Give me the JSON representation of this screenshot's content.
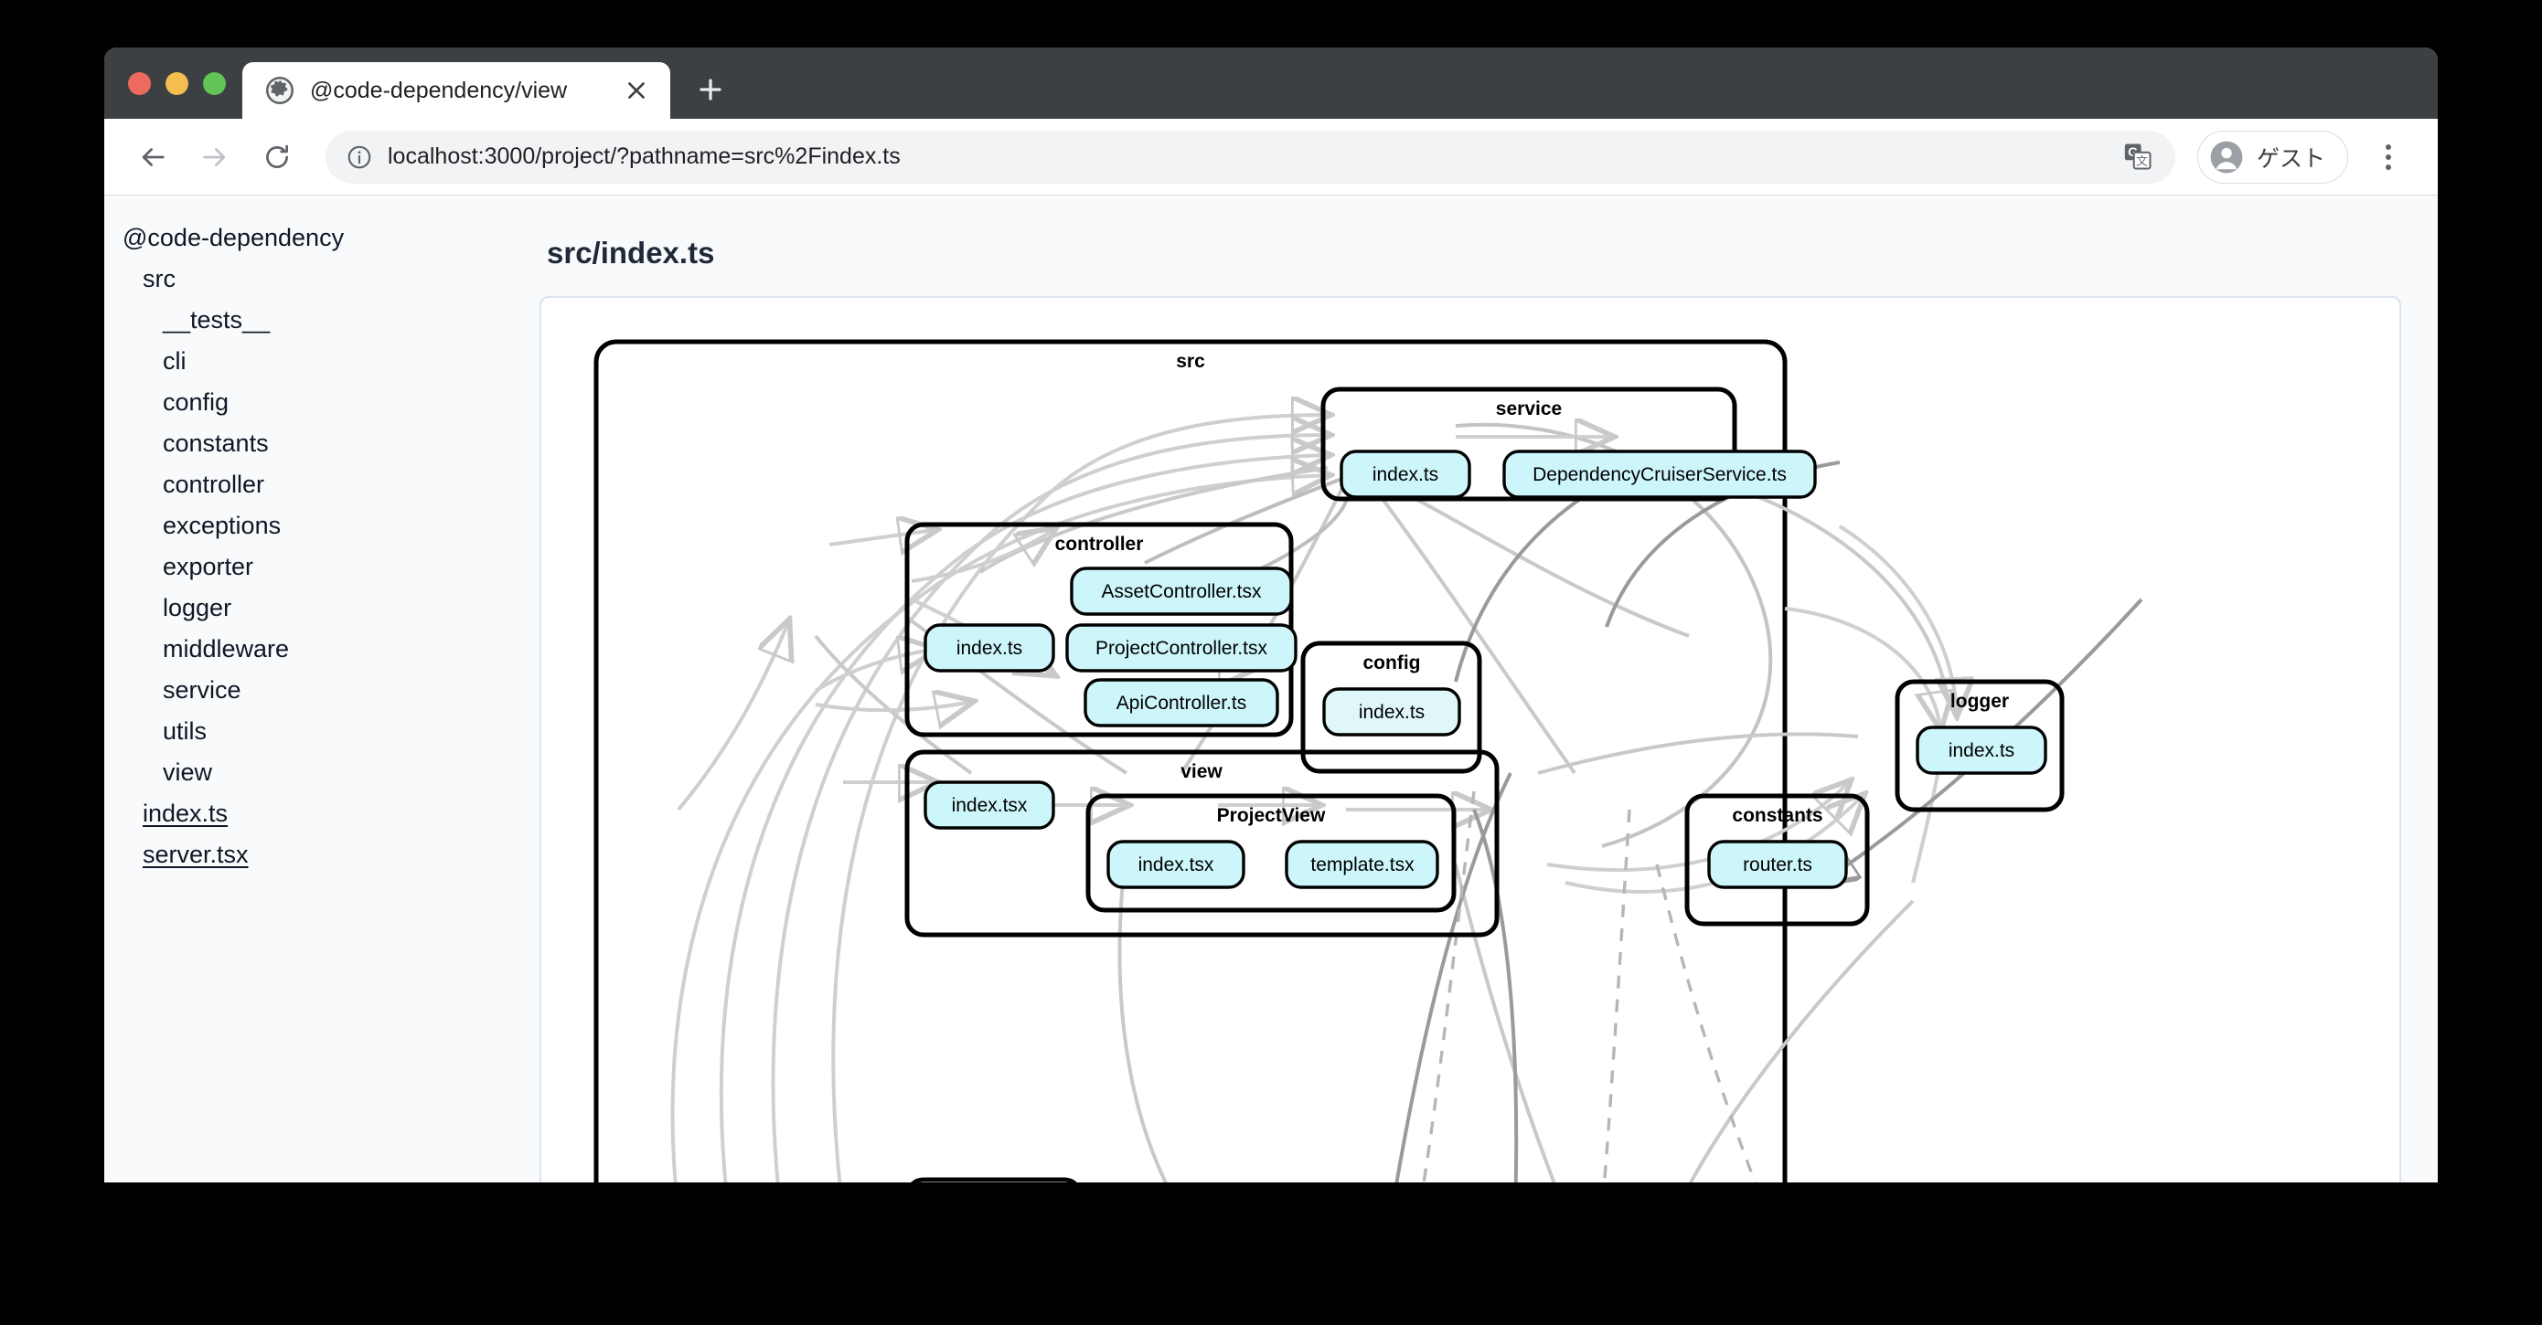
{
  "window": {
    "traffic_lights": [
      "close",
      "minimize",
      "maximize"
    ],
    "tab": {
      "title": "@code-dependency/view",
      "favicon": "globe-icon",
      "close": "×",
      "new_tab": "+"
    },
    "toolbar": {
      "back": "←",
      "forward": "→",
      "reload": "⟳",
      "url": "localhost:3000/project/?pathname=src%2Findex.ts",
      "info_icon": "info-circle-icon",
      "translate_icon": "translate-icon",
      "profile_name": "ゲスト",
      "menu_icon": "kebab-menu-icon"
    }
  },
  "sidebar": {
    "items": [
      {
        "label": "@code-dependency",
        "indent": 0,
        "kind": "root"
      },
      {
        "label": "src",
        "indent": 1,
        "kind": "folder"
      },
      {
        "label": "__tests__",
        "indent": 2,
        "kind": "folder"
      },
      {
        "label": "cli",
        "indent": 2,
        "kind": "folder"
      },
      {
        "label": "config",
        "indent": 2,
        "kind": "folder"
      },
      {
        "label": "constants",
        "indent": 2,
        "kind": "folder"
      },
      {
        "label": "controller",
        "indent": 2,
        "kind": "folder"
      },
      {
        "label": "exceptions",
        "indent": 2,
        "kind": "folder"
      },
      {
        "label": "exporter",
        "indent": 2,
        "kind": "folder"
      },
      {
        "label": "logger",
        "indent": 2,
        "kind": "folder"
      },
      {
        "label": "middleware",
        "indent": 2,
        "kind": "folder"
      },
      {
        "label": "service",
        "indent": 2,
        "kind": "folder"
      },
      {
        "label": "utils",
        "indent": 2,
        "kind": "folder"
      },
      {
        "label": "view",
        "indent": 2,
        "kind": "folder"
      },
      {
        "label": "index.ts",
        "indent": 1,
        "kind": "file"
      },
      {
        "label": "server.tsx",
        "indent": 1,
        "kind": "file"
      }
    ]
  },
  "main": {
    "page_title": "src/index.ts"
  },
  "graph": {
    "colors": {
      "node_fill": "#cdf6fb",
      "node_fill_pale": "#e0f7fa",
      "node_stroke": "#000000",
      "cluster_stroke": "#000000",
      "edge_light": "#cfcfcf",
      "edge_dark": "#9a9a9a"
    },
    "clusters": [
      {
        "id": "src",
        "label": "src"
      },
      {
        "id": "service",
        "label": "service"
      },
      {
        "id": "controller",
        "label": "controller"
      },
      {
        "id": "config",
        "label": "config"
      },
      {
        "id": "view",
        "label": "view"
      },
      {
        "id": "projectview",
        "label": "ProjectView"
      },
      {
        "id": "constants",
        "label": "constants"
      },
      {
        "id": "logger",
        "label": "logger"
      },
      {
        "id": "cutoff",
        "label": ""
      }
    ],
    "nodes": [
      {
        "id": "service_index",
        "label": "index.ts",
        "cluster": "service"
      },
      {
        "id": "dep_cruiser",
        "label": "DependencyCruiserService.ts",
        "cluster": "service"
      },
      {
        "id": "ctrl_index",
        "label": "index.ts",
        "cluster": "controller"
      },
      {
        "id": "asset_ctrl",
        "label": "AssetController.tsx",
        "cluster": "controller"
      },
      {
        "id": "project_ctrl",
        "label": "ProjectController.tsx",
        "cluster": "controller"
      },
      {
        "id": "api_ctrl",
        "label": "ApiController.ts",
        "cluster": "controller"
      },
      {
        "id": "config_index",
        "label": "index.ts",
        "cluster": "config"
      },
      {
        "id": "view_index",
        "label": "index.tsx",
        "cluster": "view"
      },
      {
        "id": "pv_index",
        "label": "index.tsx",
        "cluster": "projectview"
      },
      {
        "id": "pv_template",
        "label": "template.tsx",
        "cluster": "projectview"
      },
      {
        "id": "const_router",
        "label": "router.ts",
        "cluster": "constants"
      },
      {
        "id": "logger_index",
        "label": "index.ts",
        "cluster": "logger"
      }
    ]
  }
}
